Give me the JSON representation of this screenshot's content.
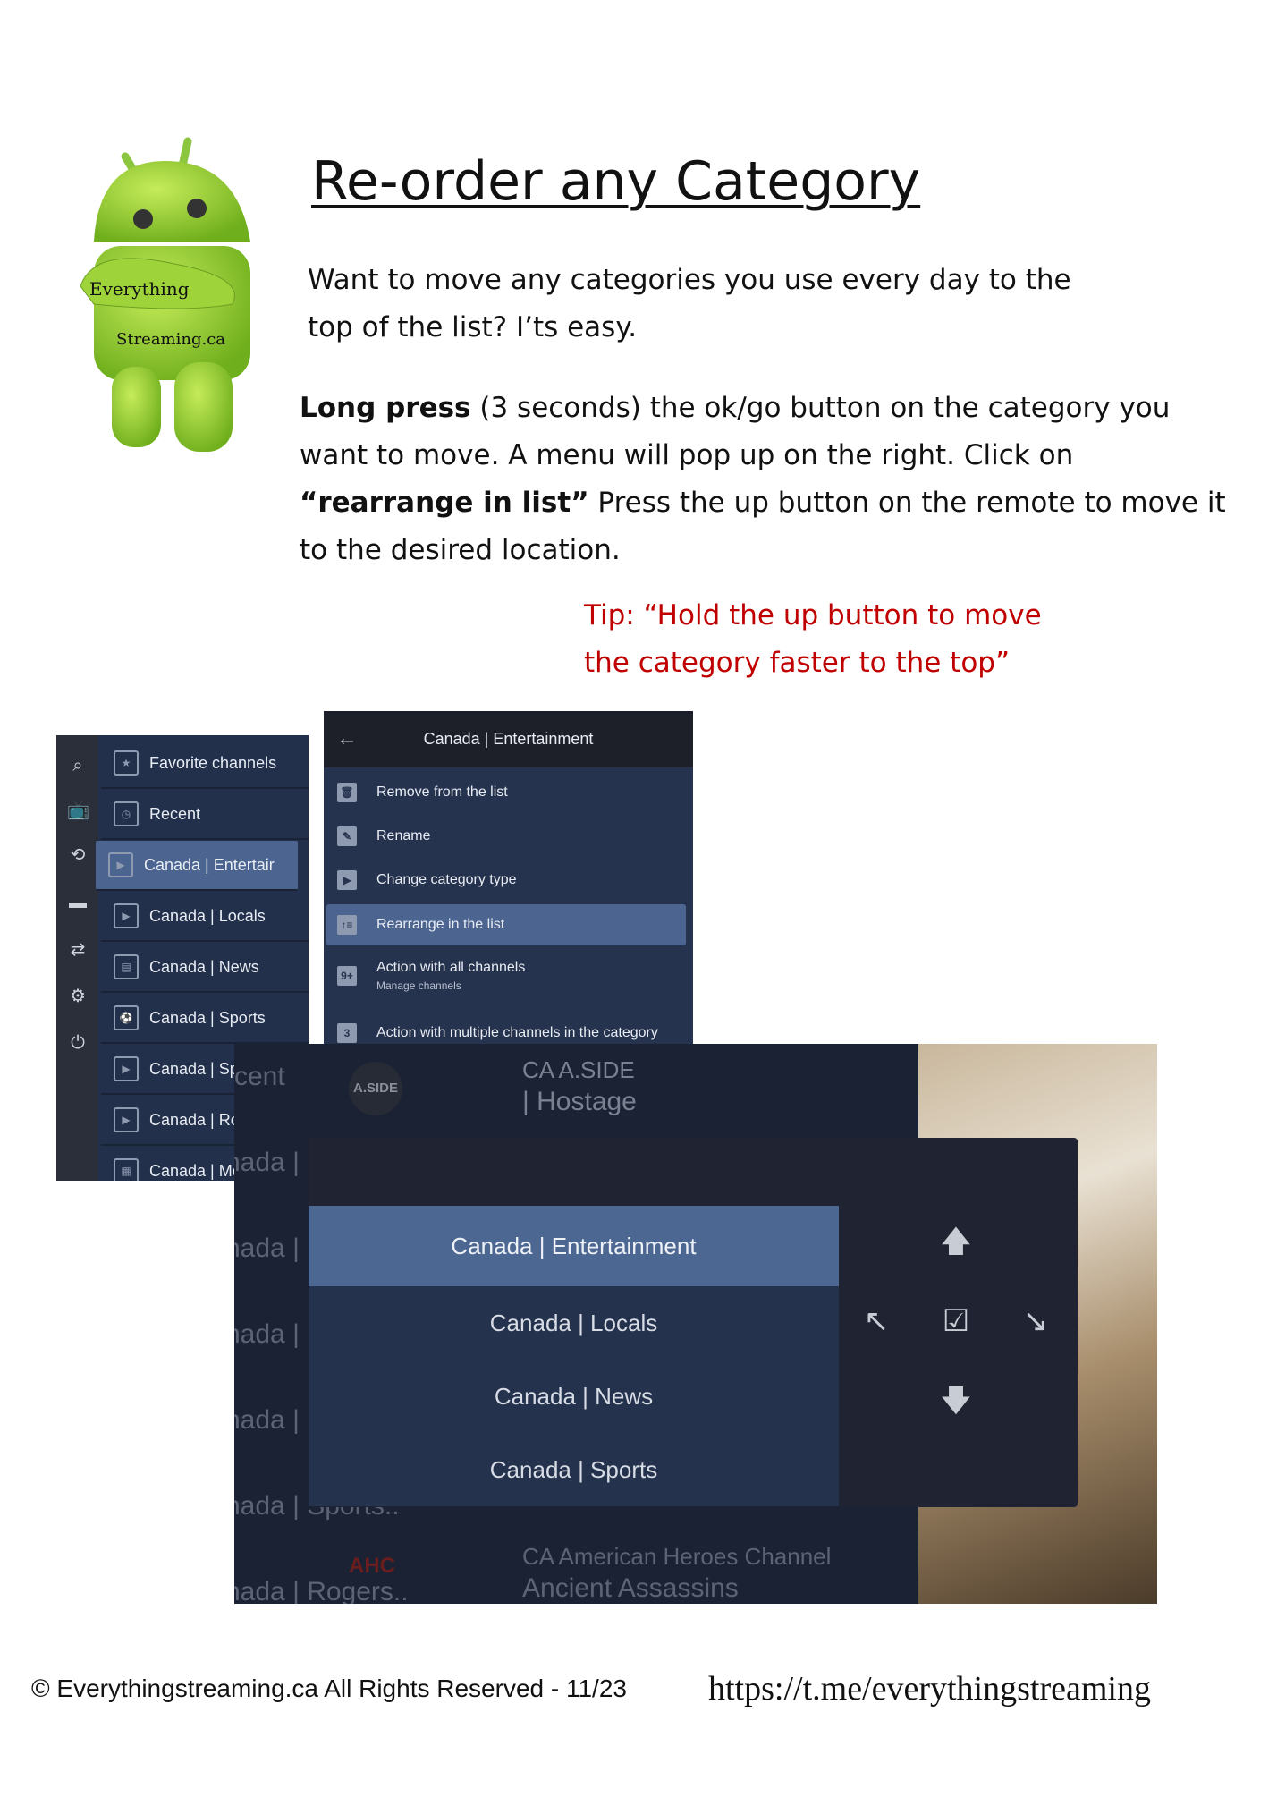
{
  "logo": {
    "text_line1": "Everything",
    "text_line2": "Streaming.ca",
    "color": "#8cc63f"
  },
  "title": "Re-order any Category",
  "intro": "Want to move any categories you use every day to the top of the list?  I’ts easy.",
  "instructions": {
    "bold1": "Long press",
    "text1": " (3 seconds) the ok/go button on the category you want to move.  A menu will pop up on the right. Click on ",
    "bold2": "“rearrange in list”",
    "text2": "  Press the up button on the remote to move it to the desired location."
  },
  "tip": {
    "line1": "Tip: “Hold the up button to move",
    "line2": "the category faster to the top”",
    "color": "#c00000"
  },
  "screenshot1": {
    "rail_icons": [
      "search-icon",
      "tv-icon",
      "history-icon",
      "movie-icon",
      "swap-icon",
      "gear-icon",
      "power-icon"
    ],
    "items": [
      {
        "label": "Favorite channels",
        "icon": "★"
      },
      {
        "label": "Recent",
        "icon": "◷"
      },
      {
        "label": "Canada | Entertair",
        "icon": "▶",
        "selected": true
      },
      {
        "label": "Canada | Locals",
        "icon": "▶"
      },
      {
        "label": "Canada | News",
        "icon": "▤"
      },
      {
        "label": "Canada | Sports",
        "icon": "⚽"
      },
      {
        "label": "Canada | Sp",
        "icon": "▶"
      },
      {
        "label": "Canada | Ro",
        "icon": "▶"
      },
      {
        "label": "Canada | Mc",
        "icon": "▦"
      }
    ]
  },
  "screenshot2": {
    "title": "Canada | Entertainment",
    "back": "←",
    "items": [
      {
        "label": "Remove from the list",
        "icon": "🗑"
      },
      {
        "label": "Rename",
        "icon": "✎"
      },
      {
        "label": "Change category type",
        "icon": "▶"
      },
      {
        "label": "Rearrange in the list",
        "icon": "↑≡",
        "selected": true
      },
      {
        "label": "Action with all channels",
        "sub": "Manage channels",
        "icon": "9+"
      },
      {
        "label": "Action with multiple channels in the category",
        "icon": "3"
      }
    ]
  },
  "screenshot3": {
    "background_items": [
      "cent",
      "nada |",
      "nada |",
      "nada |",
      "nada |",
      "nada | Sports..",
      "nada | Rogers.."
    ],
    "channels": [
      {
        "name": "CA A.SIDE",
        "program": "| Hostage",
        "logo": "A.SIDE"
      },
      {
        "name": "CA American Heroes Channel",
        "program": "Ancient Assassins",
        "logo": "AHC"
      }
    ],
    "list": [
      "Canada | Entertainment",
      "Canada | Locals",
      "Canada | News",
      "Canada | Sports"
    ],
    "selected_index": 0,
    "controls": {
      "up": "🡅",
      "top": "↖",
      "confirm": "☑",
      "bottom": "↘",
      "down": "🡇"
    }
  },
  "footer": {
    "copyright": "© Everythingstreaming.ca All Rights Reserved - 11/23",
    "url": "https://t.me/everythingstreaming"
  }
}
